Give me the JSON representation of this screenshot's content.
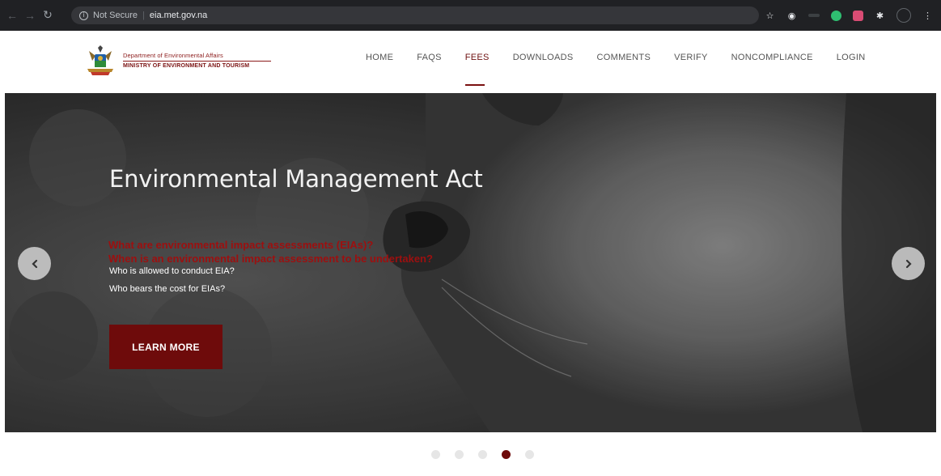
{
  "browser": {
    "security_label": "Not Secure",
    "url": "eia.met.gov.na",
    "nav_icons": [
      "back-icon",
      "forward-icon",
      "reload-icon"
    ],
    "extension_icons": [
      "star-icon",
      "puzzle-icon",
      "extensions-icon"
    ]
  },
  "header": {
    "brand_line1": "Department of Environmental Affairs",
    "brand_line2": "MINISTRY OF ENVIRONMENT AND TOURISM",
    "nav": [
      {
        "label": "HOME"
      },
      {
        "label": "FAQS"
      },
      {
        "label": "FEES"
      },
      {
        "label": "DOWNLOADS"
      },
      {
        "label": "COMMENTS"
      },
      {
        "label": "VERIFY"
      },
      {
        "label": "NONCOMPLIANCE"
      },
      {
        "label": "LOGIN"
      }
    ],
    "active_nav": "FEES",
    "accent_color": "#6e0b0b"
  },
  "hero": {
    "title": "Environmental Management Act",
    "line1": "What are environmental impact assessments (EIAs)?",
    "line2": "When is an environmental impact assessment to be undertaken?",
    "line3": "Who is allowed to conduct EIA?",
    "line4": "Who bears the cost for EIAs?",
    "cta_label": "LEARN MORE"
  },
  "carousel": {
    "slide_count": 5,
    "active_index": 3
  }
}
